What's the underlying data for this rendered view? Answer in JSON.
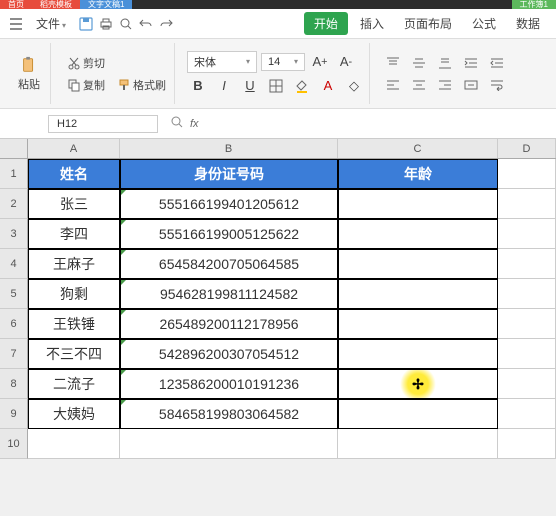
{
  "tabs": {
    "t1": "首页",
    "t2": "稻壳模板",
    "t3": "文字文稿1",
    "t4": "工作簿1"
  },
  "menu": {
    "file": "文件",
    "start": "开始",
    "insert": "插入",
    "pageLayout": "页面布局",
    "formula": "公式",
    "data": "数据"
  },
  "tools": {
    "paste": "粘贴",
    "cut": "剪切",
    "copy": "复制",
    "formatPainter": "格式刷",
    "font": "宋体",
    "fontSize": "14"
  },
  "namebox": "H12",
  "cols": {
    "a": "A",
    "b": "B",
    "c": "C",
    "d": "D"
  },
  "headers": {
    "name": "姓名",
    "id": "身份证号码",
    "age": "年龄"
  },
  "rows": [
    {
      "n": "1"
    },
    {
      "n": "2",
      "name": "张三",
      "id": "555166199401205612"
    },
    {
      "n": "3",
      "name": "李四",
      "id": "555166199005125622"
    },
    {
      "n": "4",
      "name": "王麻子",
      "id": "654584200705064585"
    },
    {
      "n": "5",
      "name": "狗剩",
      "id": "954628199811124582"
    },
    {
      "n": "6",
      "name": "王铁锤",
      "id": "265489200112178956"
    },
    {
      "n": "7",
      "name": "不三不四",
      "id": "542896200307054512"
    },
    {
      "n": "8",
      "name": "二流子",
      "id": "123586200010191236"
    },
    {
      "n": "9",
      "name": "大姨妈",
      "id": "584658199803064582"
    },
    {
      "n": "10"
    }
  ]
}
